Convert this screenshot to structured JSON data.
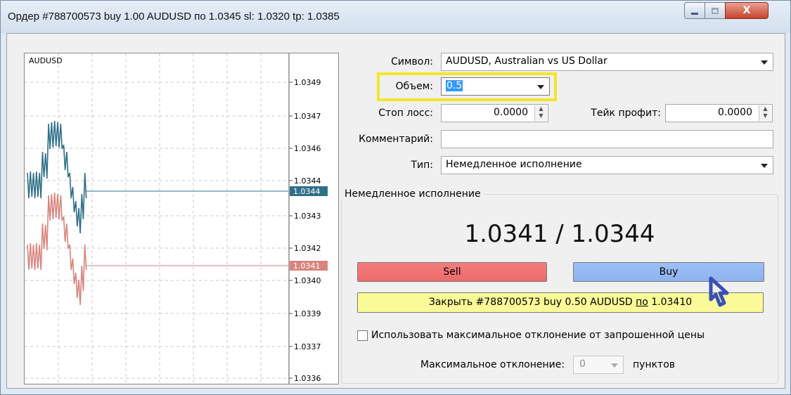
{
  "window": {
    "title": "Ордер #788700573 buy 1.00 AUDUSD по 1.0345 sl: 1.0320 tp: 1.0385",
    "close_glyph": "X"
  },
  "chart": {
    "symbol": "AUDUSD",
    "price_labels": [
      "1.0349",
      "1.0347",
      "1.0346",
      "1.0344",
      "1.0343",
      "1.0342",
      "1.0340",
      "1.0339",
      "1.0337",
      "1.0336"
    ],
    "ask_marker": "1.0344",
    "bid_marker": "1.0341",
    "ask_color": "#2f6f88",
    "bid_color": "#d9847d"
  },
  "form": {
    "symbol_label": "Символ:",
    "symbol_value": "AUDUSD, Australian vs US Dollar",
    "volume_label": "Объем:",
    "volume_value": "0.5",
    "stoploss_label": "Стоп лосс:",
    "stoploss_value": "0.0000",
    "takeprofit_label": "Тейк профит:",
    "takeprofit_value": "0.0000",
    "comment_label": "Комментарий:",
    "comment_value": "",
    "type_label": "Тип:",
    "type_value": "Немедленное исполнение"
  },
  "execution": {
    "group_title": "Немедленное исполнение",
    "bid": "1.0341",
    "ask": "1.0344",
    "separator": " / ",
    "sell_label": "Sell",
    "buy_label": "Buy",
    "close_prefix": "Закрыть #788700573 buy 0.50 AUDUSD ",
    "close_po": "по",
    "close_price": " 1.03410",
    "maxdev_checkbox_label": "Использовать максимальное отклонение от запрошенной цены",
    "maxdev_label": "Максимальное отклонение:",
    "maxdev_value": "0",
    "maxdev_unit": "пунктов"
  },
  "colors": {
    "sell": "#ed6b6b",
    "buy": "#8db2ef",
    "close": "#fafa98",
    "highlight": "#f2e62a",
    "cursor": "#3a4fb5"
  }
}
